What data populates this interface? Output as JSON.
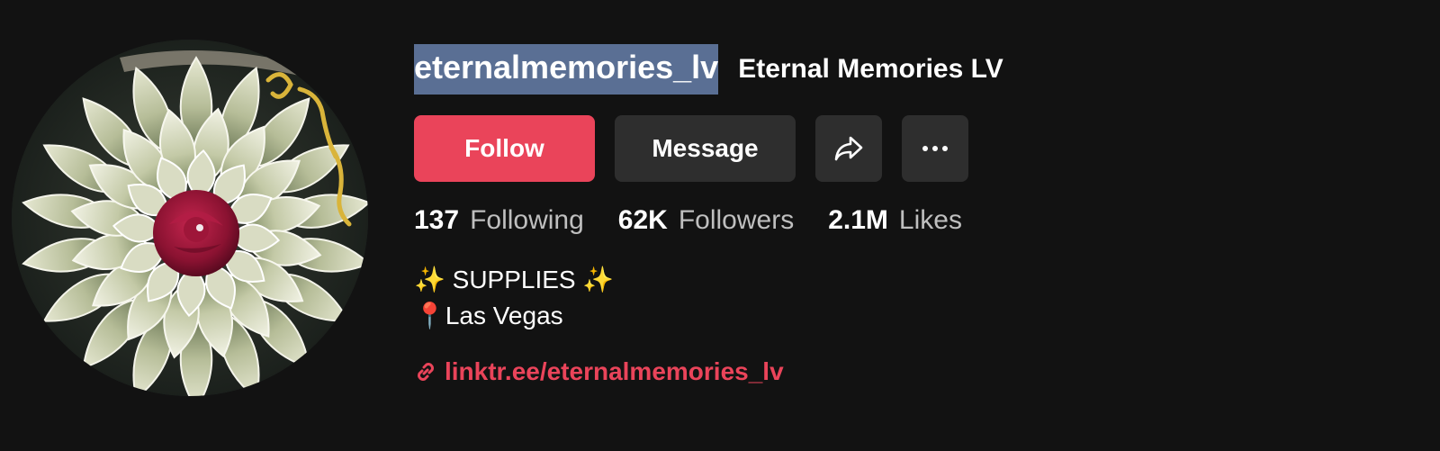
{
  "profile": {
    "username": "eternalmemories_lv",
    "display_name": "Eternal Memories LV",
    "avatar_icon": "money-flower-birthday-avatar"
  },
  "actions": {
    "follow_label": "Follow",
    "message_label": "Message",
    "share_icon": "share-arrow-icon",
    "more_icon": "more-dots-icon"
  },
  "stats": {
    "following_count": "137",
    "following_label": "Following",
    "followers_count": "62K",
    "followers_label": "Followers",
    "likes_count": "2.1M",
    "likes_label": "Likes"
  },
  "bio": {
    "line1": "✨ SUPPLIES ✨",
    "line2": "📍Las Vegas"
  },
  "link": {
    "text": "linktr.ee/eternalmemories_lv",
    "icon": "link-icon"
  },
  "colors": {
    "background": "#121212",
    "accent": "#ea445a",
    "button_secondary": "#2e2e2e",
    "selection": "#5a6f94"
  }
}
